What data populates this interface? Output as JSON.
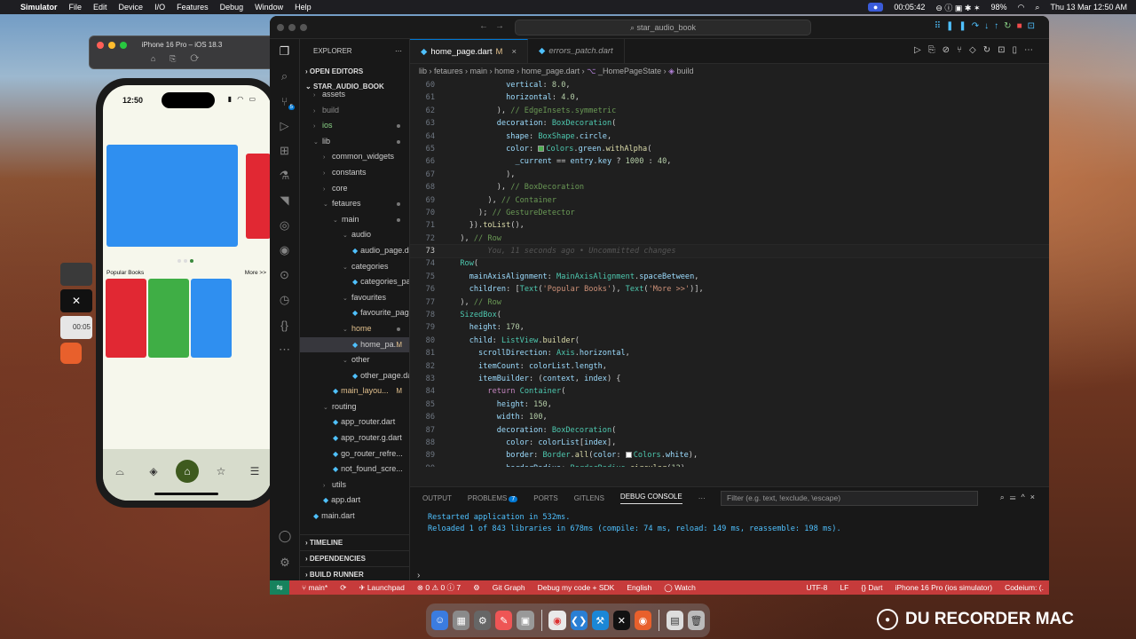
{
  "menubar": {
    "app": "Simulator",
    "menus": [
      "File",
      "Edit",
      "Device",
      "I/O",
      "Features",
      "Debug",
      "Window",
      "Help"
    ],
    "recording_time": "00:05:42",
    "battery": "98%",
    "clock": "Thu 13 Mar  12:50 AM"
  },
  "simulator": {
    "window_title": "iPhone 16 Pro – iOS 18.3",
    "status_time": "12:50",
    "popular_label": "Popular Books",
    "more_label": "More >>",
    "carousel_colors": [
      "#2f8ff0",
      "#e12833"
    ],
    "book_colors": [
      "#e12833",
      "#3fae45",
      "#2f8ff0"
    ],
    "active_dot_color": "#3b8a3e",
    "side_tile_text": "00:05"
  },
  "vscode": {
    "command_center": "star_audio_book",
    "explorer_title": "EXPLORER",
    "sections": {
      "open_editors": "OPEN EDITORS",
      "project": "STAR_AUDIO_BOOK",
      "timeline": "TIMELINE",
      "dependencies": "DEPENDENCIES",
      "build_runner": "BUILD RUNNER"
    },
    "tree": [
      {
        "label": "assets",
        "indent": 1,
        "chev": "›"
      },
      {
        "label": "build",
        "indent": 1,
        "chev": "›",
        "style": "dim"
      },
      {
        "label": "ios",
        "indent": 1,
        "chev": "›",
        "dot": true
      },
      {
        "label": "lib",
        "indent": 1,
        "chev": "⌄",
        "dot": true
      },
      {
        "label": "common_widgets",
        "indent": 2,
        "chev": "›"
      },
      {
        "label": "constants",
        "indent": 2,
        "chev": "›"
      },
      {
        "label": "core",
        "indent": 2,
        "chev": "›"
      },
      {
        "label": "fetaures",
        "indent": 2,
        "chev": "⌄",
        "dot": true
      },
      {
        "label": "main",
        "indent": 3,
        "chev": "⌄",
        "dot": true
      },
      {
        "label": "audio",
        "indent": 4,
        "chev": "⌄"
      },
      {
        "label": "audio_page.dart",
        "indent": 5,
        "dart": true
      },
      {
        "label": "categories",
        "indent": 4,
        "chev": "⌄"
      },
      {
        "label": "categories_pa...",
        "indent": 5,
        "dart": true
      },
      {
        "label": "favourites",
        "indent": 4,
        "chev": "⌄"
      },
      {
        "label": "favourite_page...",
        "indent": 5,
        "dart": true
      },
      {
        "label": "home",
        "indent": 4,
        "chev": "⌄",
        "dot": true,
        "style": "mod"
      },
      {
        "label": "home_pa...",
        "indent": 5,
        "dart": true,
        "mark": "M",
        "style": "sel"
      },
      {
        "label": "other",
        "indent": 4,
        "chev": "⌄"
      },
      {
        "label": "other_page.dart",
        "indent": 5,
        "dart": true
      },
      {
        "label": "main_layou...",
        "indent": 3,
        "dart": true,
        "mark": "M",
        "style": "mod"
      },
      {
        "label": "routing",
        "indent": 2,
        "chev": "⌄"
      },
      {
        "label": "app_router.dart",
        "indent": 3,
        "dart": true
      },
      {
        "label": "app_router.g.dart",
        "indent": 3,
        "dart": true
      },
      {
        "label": "go_router_refre...",
        "indent": 3,
        "dart": true
      },
      {
        "label": "not_found_scre...",
        "indent": 3,
        "dart": true
      },
      {
        "label": "utils",
        "indent": 2,
        "chev": "›"
      },
      {
        "label": "app.dart",
        "indent": 2,
        "dart": true
      },
      {
        "label": "main.dart",
        "indent": 1,
        "dart": true
      }
    ],
    "tabs": [
      {
        "label": "home_page.dart",
        "mark": "M",
        "active": true
      },
      {
        "label": "errors_patch.dart",
        "mark": "",
        "active": false
      }
    ],
    "breadcrumb": [
      "lib",
      "fetaures",
      "main",
      "home",
      "home_page.dart",
      "_HomePageState",
      "build"
    ],
    "code_start_line": 60,
    "current_line": 73,
    "ghost_text": "You, 11 seconds ago • Uncommitted changes",
    "panel_tabs": [
      "OUTPUT",
      "PROBLEMS",
      "PORTS",
      "GITLENS",
      "DEBUG CONSOLE"
    ],
    "problems_count": "7",
    "filter_placeholder": "Filter (e.g. text, !exclude, \\escape)",
    "console_lines": [
      "Restarted application in 532ms.",
      "Reloaded 1 of 843 libraries in 678ms (compile: 74 ms, reload: 149 ms, reassemble: 198 ms)."
    ],
    "status": {
      "branch": "main*",
      "launchpad": "Launchpad",
      "errors": "0",
      "warnings": "0",
      "info": "7",
      "git_graph": "Git Graph",
      "debug_mode": "Debug my code + SDK",
      "language_pack": "English",
      "watch": "Watch",
      "encoding": "UTF-8",
      "eol": "LF",
      "lang": "Dart",
      "device": "iPhone 16 Pro (ios simulator)",
      "codeium": "Codeium: (."
    }
  },
  "watermark": "DU RECORDER MAC"
}
